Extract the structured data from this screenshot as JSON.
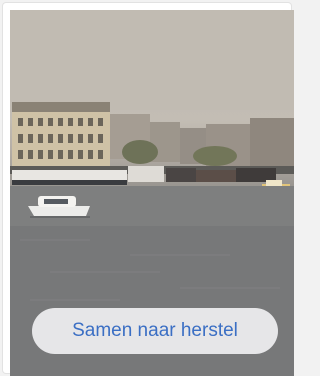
{
  "card": {
    "image_alt": "Amsterdam harbour with historic buildings and boats on the water",
    "cta_label": "Samen naar herstel"
  },
  "colors": {
    "cta_text": "#3b6fc4",
    "cta_background": "#ececee"
  }
}
